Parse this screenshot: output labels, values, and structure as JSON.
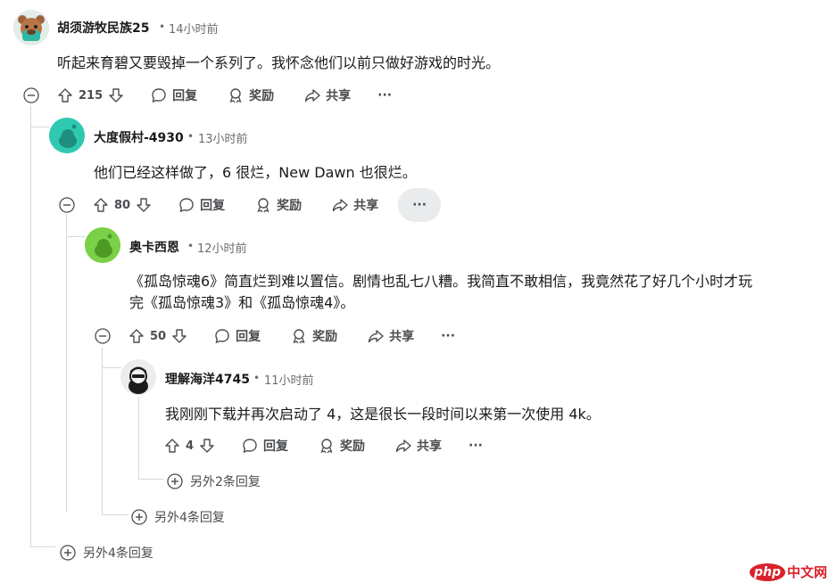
{
  "comments": [
    {
      "author": "胡须游牧民族25",
      "time": "14小时前",
      "body": "听起来育碧又要毁掉一个系列了。我怀念他们以前只做好游戏的时光。",
      "votes": "215",
      "reply_label": "回复",
      "award_label": "奖励",
      "share_label": "共享",
      "more_replies": "另外4条回复"
    },
    {
      "author": "大度假村-4930",
      "time": "13小时前",
      "body": "他们已经这样做了，6 很烂，New Dawn 也很烂。",
      "votes": "80",
      "reply_label": "回复",
      "award_label": "奖励",
      "share_label": "共享"
    },
    {
      "author": "奥卡西恩",
      "time": "12小时前",
      "body_line1": "《孤岛惊魂6》简直烂到难以置信。剧情也乱七八糟。我简直不敢相信，我竟然花了好几个小时才玩",
      "body_line2": "完《孤岛惊魂3》和《孤岛惊魂4》。",
      "votes": "50",
      "reply_label": "回复",
      "award_label": "奖励",
      "share_label": "共享",
      "more_replies": "另外4条回复"
    },
    {
      "author": "理解海洋4745",
      "time": "11小时前",
      "body": "我刚刚下载并再次启动了 4，这是很长一段时间以来第一次使用 4k。",
      "votes": "4",
      "reply_label": "回复",
      "award_label": "奖励",
      "share_label": "共享",
      "more_replies": "另外2条回复"
    }
  ],
  "separator": "•",
  "ellipsis": "···",
  "watermark": {
    "a": "php",
    "b": "中文网"
  },
  "colors": {
    "thread_line": "#d6d9db",
    "muted": "#6a6d70",
    "avatar_teal": "#2fc9b2",
    "avatar_green": "#7ad046",
    "watermark_red": "#d8232a"
  }
}
